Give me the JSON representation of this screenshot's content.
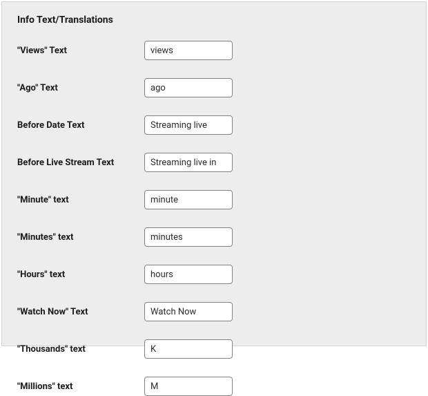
{
  "section": {
    "title": "Info Text/Translations"
  },
  "fields": {
    "views": {
      "label": "\"Views\" Text",
      "value": "views"
    },
    "ago": {
      "label": "\"Ago\" Text",
      "value": "ago"
    },
    "before_date": {
      "label": "Before Date Text",
      "value": "Streaming live"
    },
    "before_live": {
      "label": "Before Live Stream Text",
      "value": "Streaming live in"
    },
    "minute": {
      "label": "\"Minute\" text",
      "value": "minute"
    },
    "minutes": {
      "label": "\"Minutes\" text",
      "value": "minutes"
    },
    "hours": {
      "label": "\"Hours\" text",
      "value": "hours"
    },
    "watch_now": {
      "label": "\"Watch Now\" Text",
      "value": "Watch Now"
    },
    "thousands": {
      "label": "\"Thousands\" text",
      "value": "K"
    },
    "millions": {
      "label": "\"Millions\" text",
      "value": "M"
    }
  }
}
